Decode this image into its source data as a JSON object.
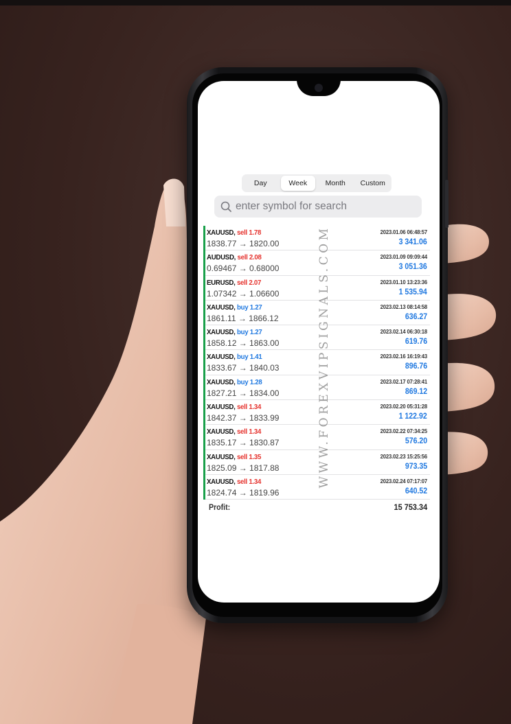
{
  "tabs": [
    {
      "label": "Day",
      "active": false
    },
    {
      "label": "Week",
      "active": true
    },
    {
      "label": "Month",
      "active": false
    },
    {
      "label": "Custom",
      "active": false
    }
  ],
  "search": {
    "placeholder": "enter symbol for search",
    "icon": "search-icon"
  },
  "trades": [
    {
      "symbol": "XAUUSD,",
      "side": "sell",
      "side_text": "sell 1.78",
      "prices": "1838.77 → 1820.00",
      "time": "2023.01.06 06:48:57",
      "profit": "3 341.06"
    },
    {
      "symbol": "AUDUSD,",
      "side": "sell",
      "side_text": "sell 2.08",
      "prices": "0.69467 → 0.68000",
      "time": "2023.01.09 09:09:44",
      "profit": "3 051.36"
    },
    {
      "symbol": "EURUSD,",
      "side": "sell",
      "side_text": "sell 2.07",
      "prices": "1.07342 → 1.06600",
      "time": "2023.01.10 13:23:36",
      "profit": "1 535.94"
    },
    {
      "symbol": "XAUUSD,",
      "side": "buy",
      "side_text": "buy 1.27",
      "prices": "1861.11 → 1866.12",
      "time": "2023.02.13 08:14:58",
      "profit": "636.27"
    },
    {
      "symbol": "XAUUSD,",
      "side": "buy",
      "side_text": "buy 1.27",
      "prices": "1858.12 → 1863.00",
      "time": "2023.02.14 06:30:18",
      "profit": "619.76"
    },
    {
      "symbol": "XAUUSD,",
      "side": "buy",
      "side_text": "buy 1.41",
      "prices": "1833.67 → 1840.03",
      "time": "2023.02.16 16:19:43",
      "profit": "896.76"
    },
    {
      "symbol": "XAUUSD,",
      "side": "buy",
      "side_text": "buy 1.28",
      "prices": "1827.21 → 1834.00",
      "time": "2023.02.17 07:28:41",
      "profit": "869.12"
    },
    {
      "symbol": "XAUUSD,",
      "side": "sell",
      "side_text": "sell 1.34",
      "prices": "1842.37 → 1833.99",
      "time": "2023.02.20 05:31:28",
      "profit": "1 122.92"
    },
    {
      "symbol": "XAUUSD,",
      "side": "sell",
      "side_text": "sell 1.34",
      "prices": "1835.17 → 1830.87",
      "time": "2023.02.22 07:34:25",
      "profit": "576.20"
    },
    {
      "symbol": "XAUUSD,",
      "side": "sell",
      "side_text": "sell 1.35",
      "prices": "1825.09 → 1817.88",
      "time": "2023.02.23 15:25:56",
      "profit": "973.35"
    },
    {
      "symbol": "XAUUSD,",
      "side": "sell",
      "side_text": "sell 1.34",
      "prices": "1824.74 → 1819.96",
      "time": "2023.02.24 07:17:07",
      "profit": "640.52"
    }
  ],
  "summary": {
    "label": "Profit:",
    "value": "15 753.34"
  },
  "watermark": "WWW.FOREXVIPSIGNALS.COM",
  "colors": {
    "sell": "#e5322d",
    "buy": "#1f78e0",
    "profit": "#1f78e0",
    "row_bar": "#19a04a"
  }
}
